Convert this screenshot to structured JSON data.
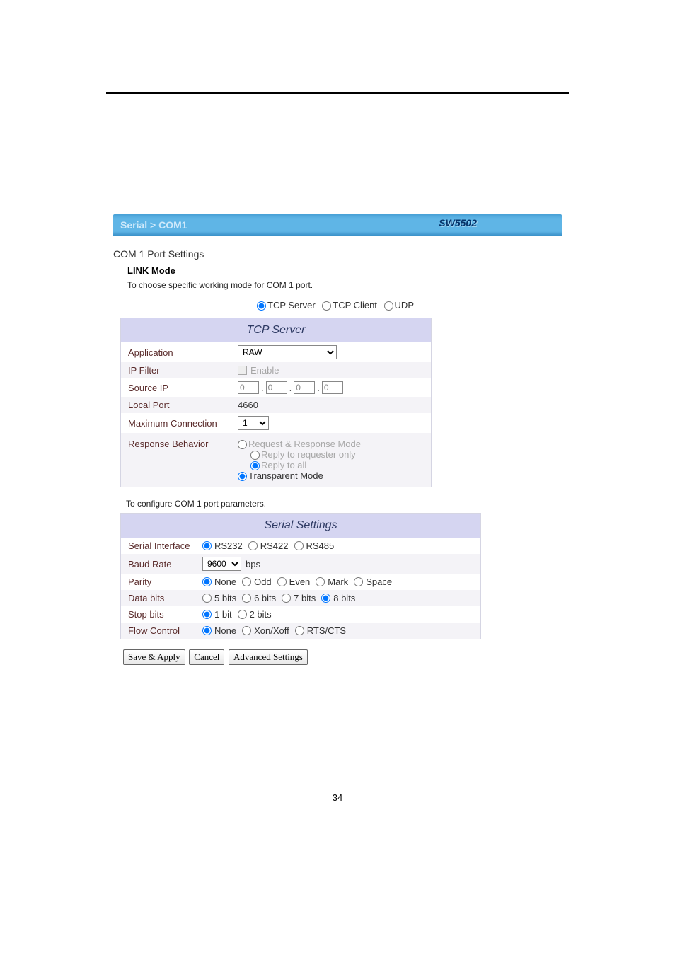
{
  "titlebar": {
    "breadcrumb": "Serial > COM1",
    "device": "SW5502"
  },
  "section_title": "COM 1 Port Settings",
  "link": {
    "heading": "LINK Mode",
    "helper": "To choose specific working mode for COM 1 port.",
    "modes": {
      "tcp_server": "TCP Server",
      "tcp_client": "TCP Client",
      "udp": "UDP"
    },
    "selected": "tcp_server"
  },
  "tcp": {
    "panel_title": "TCP Server",
    "rows": {
      "application": {
        "label": "Application",
        "value": "RAW"
      },
      "ip_filter": {
        "label": "IP Filter",
        "enable_text": "Enable",
        "checked": false
      },
      "source_ip": {
        "label": "Source IP",
        "octets": [
          "0",
          "0",
          "0",
          "0"
        ]
      },
      "local_port": {
        "label": "Local Port",
        "value": "4660"
      },
      "max_conn": {
        "label": "Maximum Connection",
        "value": "1"
      },
      "response": {
        "label": "Response Behavior",
        "opts": {
          "rr": "Request & Response Mode",
          "reply_req": "Reply to requester only",
          "reply_all": "Reply to all",
          "transparent": "Transparent Mode"
        },
        "group_selected": "transparent",
        "sub_selected": "reply_all"
      }
    }
  },
  "helper2": "To configure COM 1 port parameters.",
  "serial": {
    "panel_title": "Serial Settings",
    "rows": {
      "iface": {
        "label": "Serial Interface",
        "opts": [
          "RS232",
          "RS422",
          "RS485"
        ],
        "selected": "RS232"
      },
      "baud": {
        "label": "Baud Rate",
        "value": "9600",
        "unit": "bps"
      },
      "parity": {
        "label": "Parity",
        "opts": [
          "None",
          "Odd",
          "Even",
          "Mark",
          "Space"
        ],
        "selected": "None"
      },
      "data": {
        "label": "Data bits",
        "opts": [
          "5 bits",
          "6 bits",
          "7 bits",
          "8 bits"
        ],
        "selected": "8 bits"
      },
      "stop": {
        "label": "Stop bits",
        "opts": [
          "1 bit",
          "2 bits"
        ],
        "selected": "1 bit"
      },
      "flow": {
        "label": "Flow Control",
        "opts": [
          "None",
          "Xon/Xoff",
          "RTS/CTS"
        ],
        "selected": "None"
      }
    }
  },
  "buttons": {
    "save": "Save & Apply",
    "cancel": "Cancel",
    "adv": "Advanced Settings"
  },
  "page_number": "34"
}
